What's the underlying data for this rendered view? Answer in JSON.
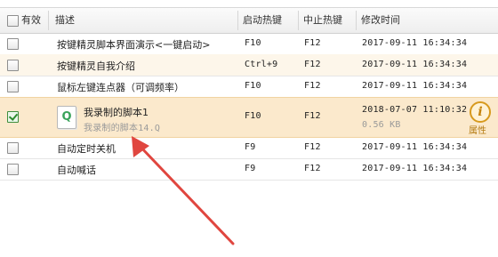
{
  "header": {
    "enabled": "有效",
    "description": "描述",
    "start_hotkey": "启动热键",
    "stop_hotkey": "中止热键",
    "modified_time": "修改时间"
  },
  "rows": [
    {
      "checked": false,
      "description": "按键精灵脚本界面演示<一键启动>",
      "start_hotkey": "F10",
      "stop_hotkey": "F12",
      "modified_time": "2017-09-11  16:34:34"
    },
    {
      "checked": false,
      "description": "按键精灵自我介绍",
      "start_hotkey": "Ctrl+9",
      "stop_hotkey": "F12",
      "modified_time": "2017-09-11  16:34:34"
    },
    {
      "checked": false,
      "description": "鼠标左键连点器（可调频率）",
      "start_hotkey": "F10",
      "stop_hotkey": "F12",
      "modified_time": "2017-09-11  16:34:34"
    },
    {
      "checked": true,
      "description": "我录制的脚本1",
      "filename": "我录制的脚本14.Q",
      "file_icon_letter": "Q",
      "start_hotkey": "F10",
      "stop_hotkey": "F12",
      "modified_time": "2018-07-07  11:10:32",
      "file_size": "0.56 KB",
      "properties_label": "属性"
    },
    {
      "checked": false,
      "description": "自动定时关机",
      "start_hotkey": "F9",
      "stop_hotkey": "F12",
      "modified_time": "2017-09-11  16:34:34"
    },
    {
      "checked": false,
      "description": "自动喊话",
      "start_hotkey": "F9",
      "stop_hotkey": "F12",
      "modified_time": "2017-09-11  16:34:34"
    }
  ],
  "colors": {
    "selected_row": "#fbe9cc",
    "alt_row": "#fdf6ea",
    "annotation_arrow": "#e0463f",
    "info_icon": "#d79a1e"
  }
}
